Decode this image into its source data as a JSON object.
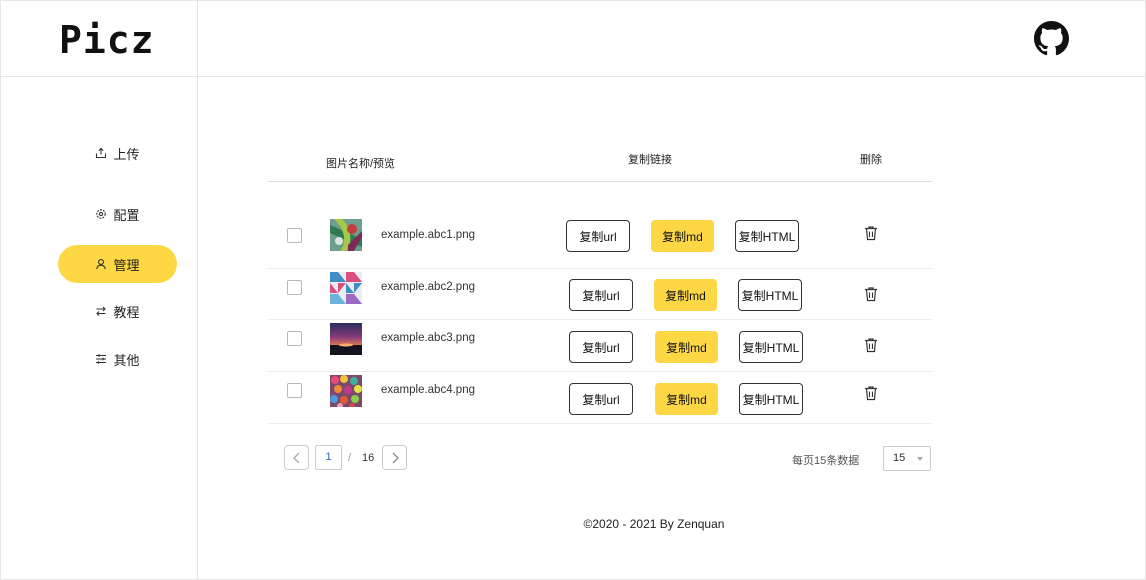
{
  "app": {
    "logo": "Picz"
  },
  "header": {
    "github_icon": "github-icon"
  },
  "sidebar": {
    "items": [
      {
        "label": "上传",
        "icon": "upload-icon",
        "active": false
      },
      {
        "label": "配置",
        "icon": "gear-icon",
        "active": false
      },
      {
        "label": "管理",
        "icon": "user-icon",
        "active": true
      },
      {
        "label": "教程",
        "icon": "swap-icon",
        "active": false
      },
      {
        "label": "其他",
        "icon": "sliders-icon",
        "active": false
      }
    ]
  },
  "table": {
    "headers": {
      "name": "图片名称/预览",
      "copy": "复制链接",
      "delete": "删除"
    },
    "rows": [
      {
        "filename": "example.abc1.png",
        "copy_url": "复制url",
        "copy_md": "复制md",
        "copy_html": "复制HTML"
      },
      {
        "filename": "example.abc2.png",
        "copy_url": "复制url",
        "copy_md": "复制md",
        "copy_html": "复制HTML"
      },
      {
        "filename": "example.abc3.png",
        "copy_url": "复制url",
        "copy_md": "复制md",
        "copy_html": "复制HTML"
      },
      {
        "filename": "example.abc4.png",
        "copy_url": "复制url",
        "copy_md": "复制md",
        "copy_html": "复制HTML"
      }
    ]
  },
  "pagination": {
    "current": "1",
    "separator": "/",
    "total": "16",
    "per_page_label": "每页15条数据",
    "per_page_value": "15"
  },
  "footer": {
    "text": "©2020 - 2021 By Zenquan"
  },
  "colors": {
    "accent": "#fdd744",
    "border": "#e6e6e6",
    "link": "#2d64c8"
  }
}
